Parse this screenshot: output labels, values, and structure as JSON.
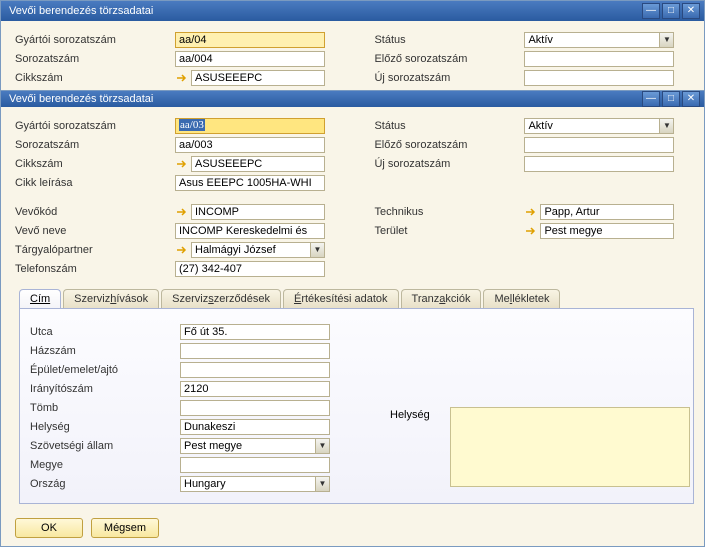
{
  "w1": {
    "title": "Vevői berendezés törzsadatai",
    "labels": {
      "gyartoi": "Gyártói sorozatszám",
      "sorozat": "Sorozatszám",
      "cikkszam": "Cikkszám",
      "status": "Státus",
      "elozo": "Előző sorozatszám",
      "uj": "Új sorozatszám"
    },
    "values": {
      "gyartoi": "aa/04",
      "sorozat": "aa/004",
      "cikkszam": "ASUSEEEPC",
      "status": "Aktív"
    }
  },
  "w2": {
    "title": "Vevői berendezés törzsadatai",
    "labels": {
      "gyartoi": "Gyártói sorozatszám",
      "sorozat": "Sorozatszám",
      "cikkszam": "Cikkszám",
      "cikkleiras": "Cikk leírása",
      "vevokod": "Vevőkód",
      "vevoneve": "Vevő neve",
      "targyalo": "Tárgyalópartner",
      "telefon": "Telefonszám",
      "status": "Státus",
      "elozo": "Előző sorozatszám",
      "uj": "Új sorozatszám",
      "technikus": "Technikus",
      "terulet": "Terület"
    },
    "values": {
      "gyartoi": "aa/03",
      "sorozat": "aa/003",
      "cikkszam": "ASUSEEEPC",
      "cikkleiras": "Asus EEEPC 1005HA-WHI",
      "vevokod": "INCOMP",
      "vevoneve": "INCOMP Kereskedelmi és",
      "targyalo": "Halmágyi József",
      "telefon": "(27) 342-407",
      "status": "Aktív",
      "technikus": "Papp, Artur",
      "terulet": "Pest megye"
    },
    "tabs": {
      "cim": "Cím",
      "szervizh": "Szervizhívások",
      "szervizsz": "Szervizszerződések",
      "ertek": "Értékesítési adatok",
      "tranz": "Tranzakciók",
      "mell": "Mellékletek"
    },
    "address": {
      "labels": {
        "utca": "Utca",
        "hazszam": "Házszám",
        "epulet": "Épület/emelet/ajtó",
        "iranyito": "Irányítószám",
        "tomb": "Tömb",
        "helyseg": "Helység",
        "szovetseg": "Szövetségi állam",
        "megye": "Megye",
        "orszag": "Ország",
        "helyseg_box": "Helység"
      },
      "values": {
        "utca": "Fő út 35.",
        "iranyito": "2120",
        "helyseg": "Dunakeszi",
        "szovetseg": "Pest megye",
        "orszag": "Hungary"
      }
    },
    "buttons": {
      "ok": "OK",
      "cancel": "Mégsem"
    }
  }
}
